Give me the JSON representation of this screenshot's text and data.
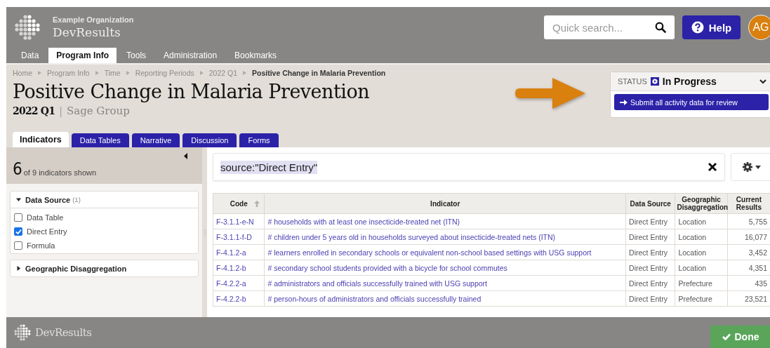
{
  "header": {
    "organization": "Example Organization",
    "app_name": "DevResults",
    "search": {
      "placeholder": "Quick search..."
    },
    "help_button": "Help",
    "avatar": "AG"
  },
  "nav_tabs": [
    {
      "label": "Data",
      "selected": false
    },
    {
      "label": "Program Info",
      "selected": true
    },
    {
      "label": "Tools",
      "selected": false
    },
    {
      "label": "Administration",
      "selected": false
    },
    {
      "label": "Bookmarks",
      "selected": false
    }
  ],
  "breadcrumbs": [
    {
      "label": "Home",
      "current": false
    },
    {
      "label": "Program Info",
      "current": false
    },
    {
      "label": "Time",
      "current": false
    },
    {
      "label": "Reporting Periods",
      "current": false
    },
    {
      "label": "2022 Q1",
      "current": false
    },
    {
      "label": "Positive Change in Malaria Prevention",
      "current": true
    }
  ],
  "title": "Positive Change in Malaria Prevention",
  "period": "2022 Q1",
  "separator": "|",
  "group": "Sage Group",
  "page_tabs": [
    {
      "label": "Indicators",
      "selected": true
    },
    {
      "label": "Data Tables",
      "selected": false
    },
    {
      "label": "Narrative",
      "selected": false
    },
    {
      "label": "Discussion",
      "selected": false
    },
    {
      "label": "Forms",
      "selected": false
    }
  ],
  "status": {
    "label": "STATUS",
    "value": "In Progress",
    "submit_button": "Submit all activity data for review"
  },
  "sidebar": {
    "count": "6",
    "count_text": "of 9 indicators shown",
    "filters": [
      {
        "title": "Data Source",
        "count": "(1)",
        "expanded": true,
        "options": [
          {
            "label": "Data Table",
            "checked": false
          },
          {
            "label": "Direct Entry",
            "checked": true
          },
          {
            "label": "Formula",
            "checked": false
          }
        ]
      },
      {
        "title": "Geographic Disaggregation",
        "expanded": false
      }
    ]
  },
  "filter_query": "source:\"Direct Entry\"",
  "table": {
    "columns": [
      "Code",
      "Indicator",
      "Data Source",
      "Geographic Disaggregation",
      "Current Results"
    ],
    "rows": [
      [
        "F-3.1.1-e-N",
        "# households with at least one insecticide-treated net (ITN)",
        "Direct Entry",
        "Location",
        "5,755"
      ],
      [
        "F-3.1.1-f-D",
        "# children under 5 years old in households surveyed about insecticide-treated nets (ITN)",
        "Direct Entry",
        "Location",
        "16,077"
      ],
      [
        "F-4.1.2-a",
        "# learners enrolled in secondary schools or equivalent non-school based settings with USG support",
        "Direct Entry",
        "Location",
        "3,452"
      ],
      [
        "F-4.1.2-b",
        "# secondary school students provided with a bicycle for school commutes",
        "Direct Entry",
        "Location",
        "4,351"
      ],
      [
        "F-4.2.2-a",
        "# administrators and officials successfully trained with USG support",
        "Direct Entry",
        "Prefecture",
        "435"
      ],
      [
        "F-4.2.2-b",
        "# person-hours of administrators and officials successfully trained",
        "Direct Entry",
        "Prefecture",
        "23,521"
      ]
    ]
  },
  "footer": {
    "brand": "DevResults",
    "done_button": "Done"
  }
}
